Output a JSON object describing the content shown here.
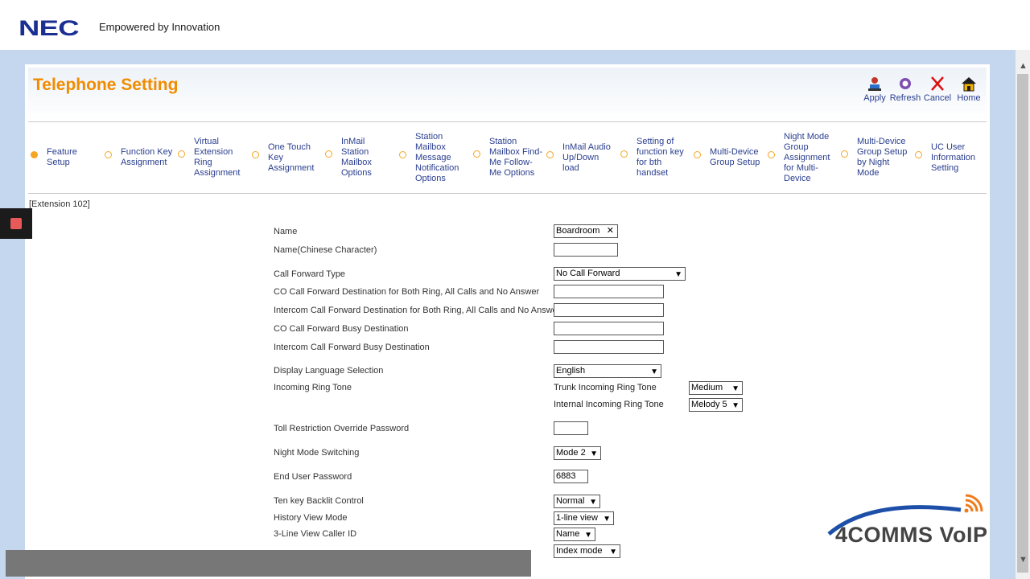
{
  "header": {
    "logo": "NEC",
    "tagline": "Empowered by Innovation"
  },
  "page": {
    "title": "Telephone Setting"
  },
  "toolbar": {
    "apply": "Apply",
    "refresh": "Refresh",
    "cancel": "Cancel",
    "home": "Home"
  },
  "tabs": [
    "Feature Setup",
    "Function Key Assignment",
    "Virtual Extension Ring Assignment",
    "One Touch Key Assignment",
    "InMail Station Mailbox Options",
    "Station Mailbox Message Notification Options",
    "Station Mailbox Find-Me Follow-Me Options",
    "InMail Audio Up/Down load",
    "Setting of function key for bth handset",
    "Multi-Device Group Setup",
    "Night Mode Group Assignment for Multi-Device",
    "Multi-Device Group Setup by Night Mode",
    "UC User Information Setting"
  ],
  "extension": "[Extension 102]",
  "form": {
    "name_label": "Name",
    "name_value": "Boardroom",
    "name_chinese_label": "Name(Chinese Character)",
    "cf_type_label": "Call Forward Type",
    "cf_type_value": "No Call Forward",
    "co_cf_dest_label": "CO Call Forward Destination for Both Ring, All Calls and No Answer",
    "ic_cf_dest_label": "Intercom Call Forward Destination for Both Ring, All Calls and No Answer",
    "co_cf_busy_label": "CO Call Forward Busy Destination",
    "ic_cf_busy_label": "Intercom Call Forward Busy Destination",
    "lang_label": "Display Language Selection",
    "lang_value": "English",
    "ring_label": "Incoming Ring Tone",
    "trunk_ring_label": "Trunk Incoming Ring Tone",
    "trunk_ring_value": "Medium",
    "internal_ring_label": "Internal Incoming Ring Tone",
    "internal_ring_value": "Melody 5",
    "toll_label": "Toll Restriction Override Password",
    "night_label": "Night Mode Switching",
    "night_value": "Mode 2",
    "password_label": "End User Password",
    "password_value": "6883",
    "backlit_label": "Ten key Backlit Control",
    "backlit_value": "Normal",
    "history_label": "History View Mode",
    "history_value": "1-line view",
    "caller_label": "3-Line View Caller ID",
    "caller_value": "Name",
    "index_value": "Index mode"
  },
  "watermark": "4COMMS VoIP"
}
